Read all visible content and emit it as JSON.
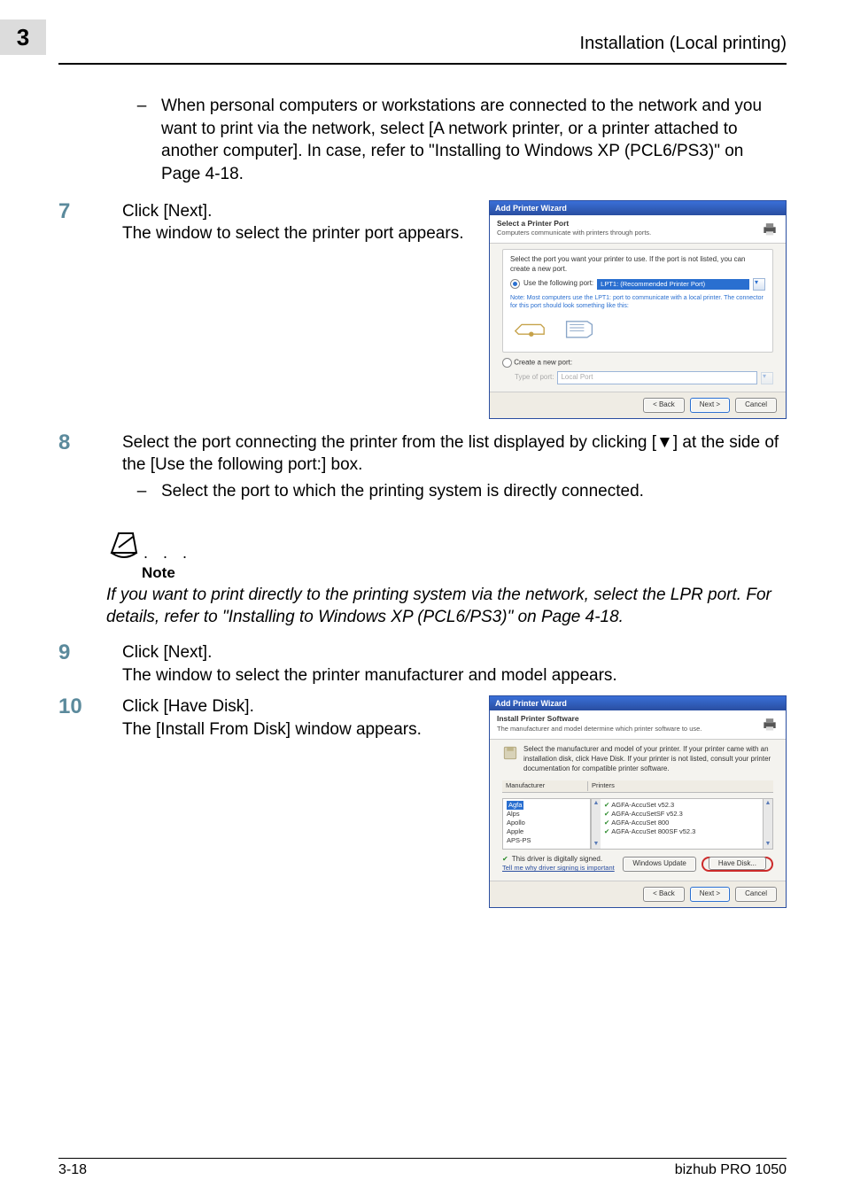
{
  "header": {
    "chapter_number": "3",
    "section_title": "Installation (Local printing)"
  },
  "bullet_dash": "–",
  "step6_bullet": "When personal computers or workstations are connected to the network and you want to print via the network, select [A network printer, or a printer attached to another computer]. In case, refer to \"Installing to Windows XP (PCL6/PS3)\" on Page 4-18.",
  "step7": {
    "num": "7",
    "line1": "Click [Next].",
    "line2": "The window to select the printer port appears."
  },
  "step8": {
    "num": "8",
    "line1": "Select the port connecting the printer from the list displayed by clicking [▼] at the side of the [Use the following port:] box.",
    "bullet": "Select the port to which the printing system is directly connected."
  },
  "note": {
    "dots": ". . .",
    "label": "Note",
    "body": "If you want to print directly to the printing system via the network, select the LPR port. For details, refer to \"Installing to Windows XP (PCL6/PS3)\" on Page 4-18."
  },
  "step9": {
    "num": "9",
    "line1": "Click [Next].",
    "line2": "The window to select the printer manufacturer and model appears."
  },
  "step10": {
    "num": "10",
    "line1": "Click [Have Disk].",
    "line2": "The [Install From Disk] window appears."
  },
  "wizard1": {
    "title": "Add Printer Wizard",
    "sub_title": "Select a Printer Port",
    "sub_desc": "Computers communicate with printers through ports.",
    "panel_top": "Select the port you want your printer to use. If the port is not listed, you can create a new port.",
    "radio_use": "Use the following port:",
    "port_selected": "LPT1: (Recommended Printer Port)",
    "note_line": "Note: Most computers use the LPT1: port to communicate with a local printer. The connector for this port should look something like this:",
    "radio_create": "Create a new port:",
    "type_of_port_label": "Type of port:",
    "type_of_port_value": "Local Port",
    "btn_back": "< Back",
    "btn_next": "Next >",
    "btn_cancel": "Cancel"
  },
  "wizard2": {
    "title": "Add Printer Wizard",
    "sub_title": "Install Printer Software",
    "sub_desc": "The manufacturer and model determine which printer software to use.",
    "instruction": "Select the manufacturer and model of your printer. If your printer came with an installation disk, click Have Disk. If your printer is not listed, consult your printer documentation for compatible printer software.",
    "col_manufacturer": "Manufacturer",
    "col_printers": "Printers",
    "manufacturers": [
      "Agfa",
      "Alps",
      "Apollo",
      "Apple",
      "APS-PS"
    ],
    "printers": [
      "AGFA-AccuSet v52.3",
      "AGFA-AccuSetSF v52.3",
      "AGFA-AccuSet 800",
      "AGFA-AccuSet 800SF v52.3"
    ],
    "signed_text": "This driver is digitally signed.",
    "tell_me_link": "Tell me why driver signing is important",
    "btn_win_update": "Windows Update",
    "btn_have_disk": "Have Disk...",
    "btn_back": "< Back",
    "btn_next": "Next >",
    "btn_cancel": "Cancel"
  },
  "footer": {
    "page_number": "3-18",
    "product": "bizhub PRO 1050"
  }
}
